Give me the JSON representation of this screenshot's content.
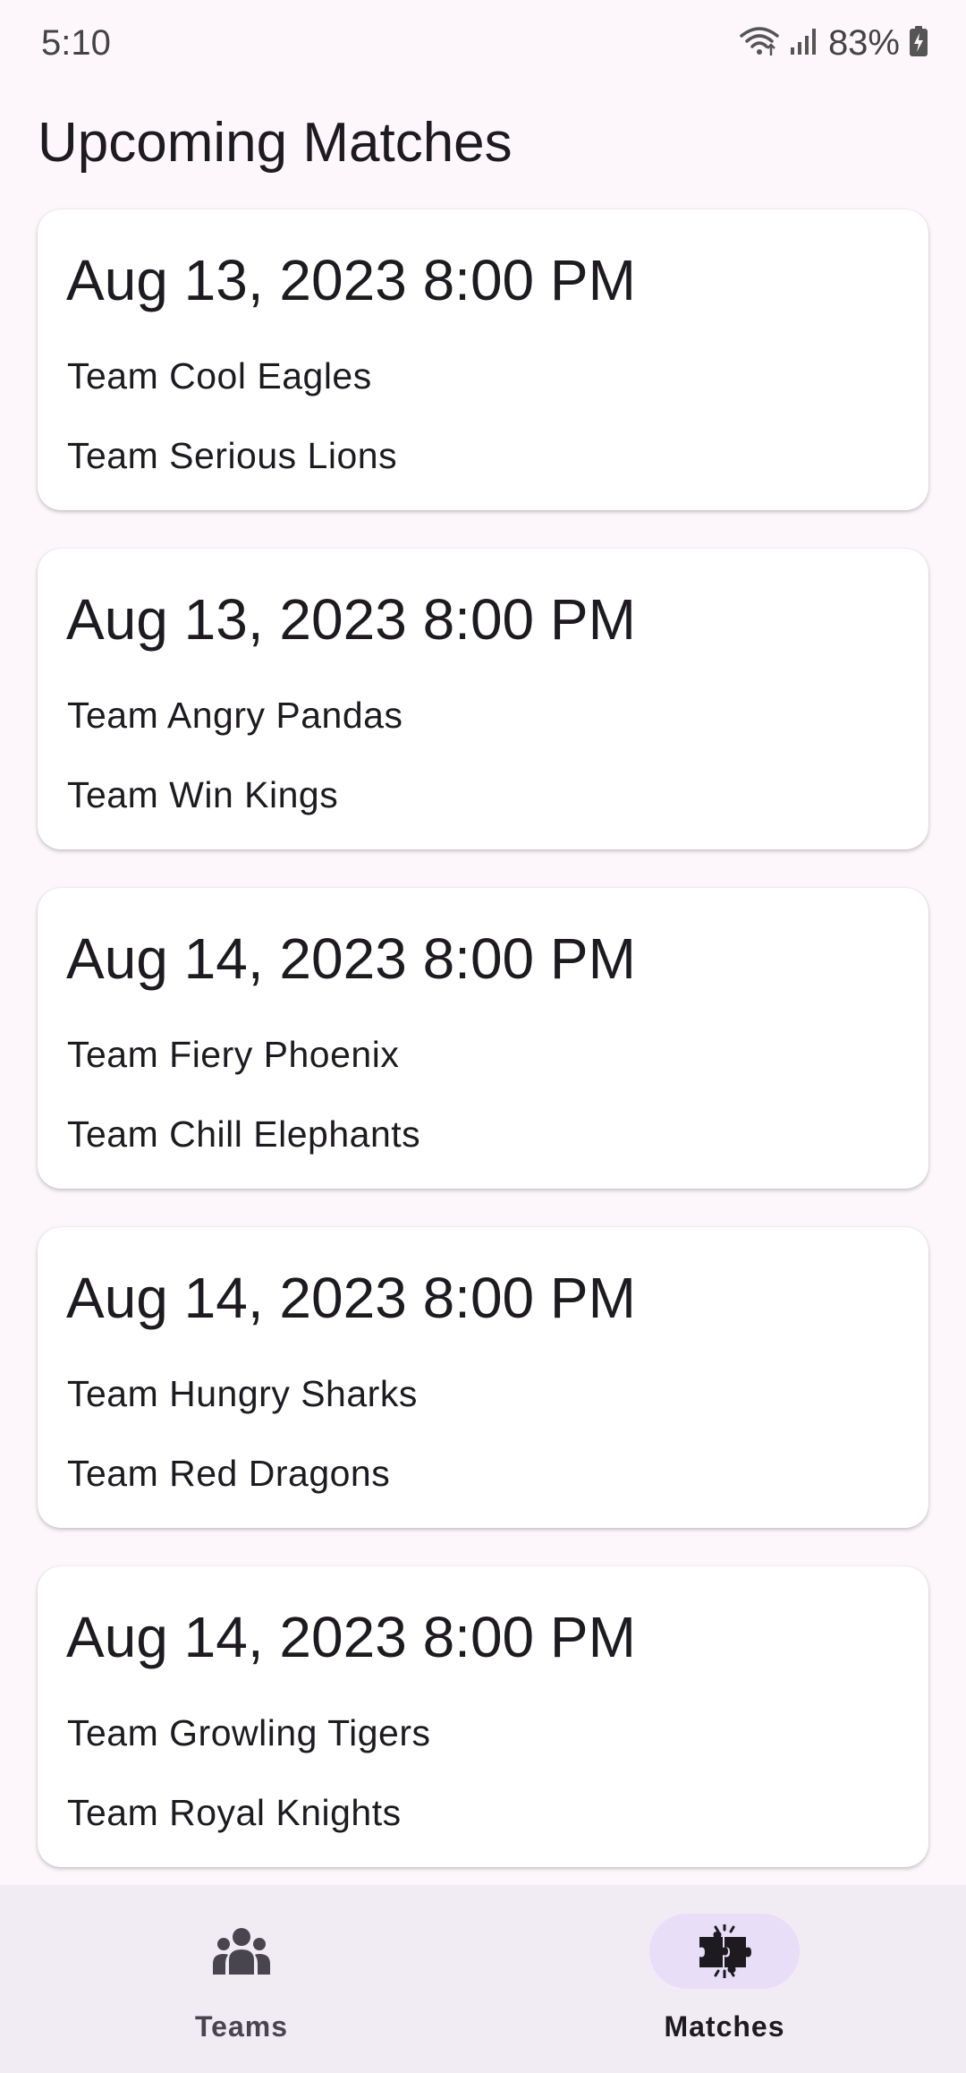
{
  "status_bar": {
    "time": "5:10",
    "battery_percent": "83%",
    "icons": [
      "wifi-icon",
      "signal-icon",
      "battery-charging-icon"
    ]
  },
  "page": {
    "title": "Upcoming Matches"
  },
  "matches": [
    {
      "datetime": "Aug 13, 2023 8:00 PM",
      "team_a": "Team Cool Eagles",
      "team_b": "Team Serious Lions"
    },
    {
      "datetime": "Aug 13, 2023 8:00 PM",
      "team_a": "Team Angry Pandas",
      "team_b": "Team Win Kings"
    },
    {
      "datetime": "Aug 14, 2023 8:00 PM",
      "team_a": "Team Fiery Phoenix",
      "team_b": "Team Chill Elephants"
    },
    {
      "datetime": "Aug 14, 2023 8:00 PM",
      "team_a": "Team Hungry Sharks",
      "team_b": "Team Red Dragons"
    },
    {
      "datetime": "Aug 14, 2023 8:00 PM",
      "team_a": "Team Growling Tigers",
      "team_b": "Team Royal Knights"
    }
  ],
  "bottom_nav": {
    "items": [
      {
        "label": "Teams",
        "icon": "groups-icon",
        "selected": false
      },
      {
        "label": "Matches",
        "icon": "matches-icon",
        "selected": true
      }
    ],
    "selected_indicator_color": "#e8def8"
  }
}
